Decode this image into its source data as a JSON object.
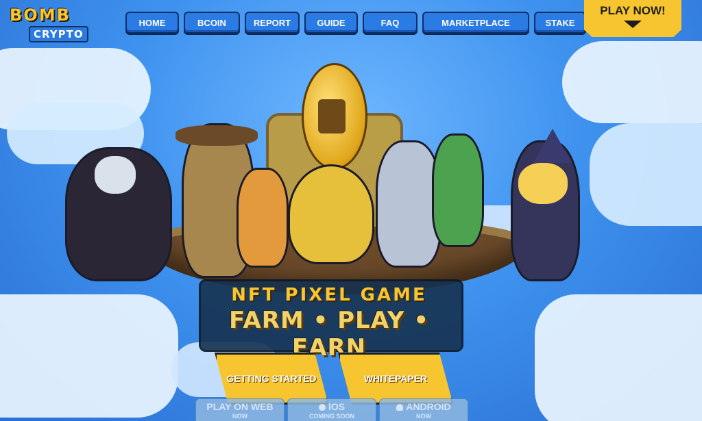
{
  "logo": {
    "line1": "BOMB",
    "line2": "CRYPTO"
  },
  "nav": {
    "items": [
      {
        "label": "HOME"
      },
      {
        "label": "BCOIN"
      },
      {
        "label": "REPORT"
      },
      {
        "label": "GUIDE"
      },
      {
        "label": "FAQ"
      },
      {
        "label": "MARKETPLACE"
      },
      {
        "label": "STAKE"
      }
    ]
  },
  "play_now": {
    "label": "PLAY NOW!"
  },
  "hero": {
    "headline": "NFT PIXEL GAME",
    "subheadline": "FARM • PLAY • EARN",
    "icons": [
      "vampire-character",
      "cowboy-character",
      "shiba-dog-character",
      "golden-frog-character",
      "knight-character",
      "pepe-frog-character",
      "witch-character",
      "gold-coin-icon"
    ]
  },
  "cta": {
    "getting_started": "GETTING STARTED",
    "whitepaper": "WHITEPAPER"
  },
  "platforms": [
    {
      "label": "PLAY ON WEB",
      "status": "NOW"
    },
    {
      "label": "IOS",
      "status": "COMING SOON",
      "icon": "apple-icon"
    },
    {
      "label": "ANDROID",
      "status": "NOW",
      "icon": "android-icon"
    }
  ],
  "colors": {
    "accent": "#f7c52f",
    "nav": "#2b7be5",
    "sky": "#3f93ef"
  }
}
